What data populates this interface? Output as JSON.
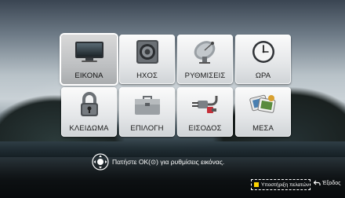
{
  "menu": {
    "items": [
      {
        "label": "ΕΙΚΟΝΑ",
        "icon": "tv-icon",
        "selected": true
      },
      {
        "label": "ΗΧΟΣ",
        "icon": "speaker-icon",
        "selected": false
      },
      {
        "label": "ΡΥΘΜΙΣΕΙΣ",
        "icon": "satellite-dish-icon",
        "selected": false
      },
      {
        "label": "ΩΡΑ",
        "icon": "clock-icon",
        "selected": false
      },
      {
        "label": "ΚΛΕΙΔΩΜΑ",
        "icon": "lock-icon",
        "selected": false
      },
      {
        "label": "ΕΠΙΛΟΓΗ",
        "icon": "briefcase-icon",
        "selected": false
      },
      {
        "label": "ΕΙΣΟΔΟΣ",
        "icon": "cable-plug-icon",
        "selected": false
      },
      {
        "label": "ΜΕΣΑ",
        "icon": "media-icon",
        "selected": false
      }
    ]
  },
  "footer": {
    "hint": "Πατήστε ΟΚ(⊙) για ρυθμίσεις εικόνας.",
    "help": "Υποστήριξη πελατών",
    "exit": "Έξοδος"
  },
  "colors": {
    "help_swatch": "#ffd400",
    "selection": "#ffffff"
  }
}
